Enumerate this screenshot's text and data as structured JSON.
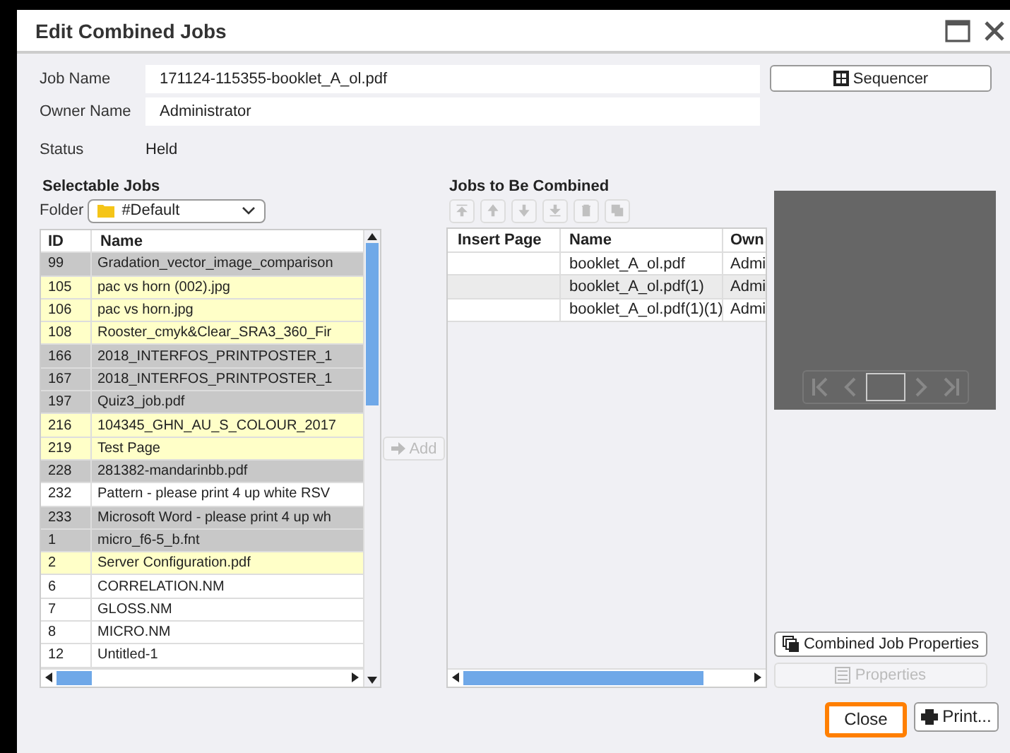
{
  "window": {
    "title": "Edit Combined Jobs"
  },
  "form": [
    {
      "label": "Job Name",
      "kind": "field",
      "value": "171124-115355-booklet_A_ol.pdf"
    },
    {
      "label": "Owner Name",
      "kind": "field",
      "value": "Administrator"
    },
    {
      "label": "Status",
      "kind": "text",
      "value": "Held"
    }
  ],
  "sequencer_button": "Sequencer",
  "selectable_jobs": {
    "title": "Selectable Jobs",
    "folder_label": "Folder",
    "folder": "#Default",
    "columns": [
      "ID",
      "Name"
    ],
    "rows": [
      {
        "id": "99",
        "name": "Gradation_vector_image_comparison",
        "color": "#c8c8c8"
      },
      {
        "id": "105",
        "name": "pac vs horn (002).jpg",
        "color": "#ffffc8"
      },
      {
        "id": "106",
        "name": "pac vs horn.jpg",
        "color": "#ffffc8"
      },
      {
        "id": "108",
        "name": "Rooster_cmyk&Clear_SRA3_360_Fir",
        "color": "#ffffc8"
      },
      {
        "id": "166",
        "name": "2018_INTERFOS_PRINTPOSTER_1",
        "color": "#c8c8c8"
      },
      {
        "id": "167",
        "name": "2018_INTERFOS_PRINTPOSTER_1",
        "color": "#c8c8c8"
      },
      {
        "id": "197",
        "name": "Quiz3_job.pdf",
        "color": "#c8c8c8"
      },
      {
        "id": "216",
        "name": "104345_GHN_AU_S_COLOUR_2017",
        "color": "#ffffc8"
      },
      {
        "id": "219",
        "name": "Test Page",
        "color": "#ffffc8"
      },
      {
        "id": "228",
        "name": "281382-mandarinbb.pdf",
        "color": "#c8c8c8"
      },
      {
        "id": "232",
        "name": "Pattern - please print 4 up white  RSV",
        "color": "#ffffff"
      },
      {
        "id": "233",
        "name": "Microsoft Word - please print 4 up wh",
        "color": "#c8c8c8"
      },
      {
        "id": "1",
        "name": "micro_f6-5_b.fnt",
        "color": "#c8c8c8"
      },
      {
        "id": "2",
        "name": "Server Configuration.pdf",
        "color": "#ffffc8"
      },
      {
        "id": "6",
        "name": "CORRELATION.NM",
        "color": "#ffffff"
      },
      {
        "id": "7",
        "name": "GLOSS.NM",
        "color": "#ffffff"
      },
      {
        "id": "8",
        "name": "MICRO.NM",
        "color": "#ffffff"
      },
      {
        "id": "12",
        "name": "Untitled-1",
        "color": "#ffffff"
      }
    ]
  },
  "add_button": {
    "label": "Add",
    "disabled": true
  },
  "jobs_to_combine": {
    "title": "Jobs to Be Combined",
    "toolbar": [
      {
        "kind": "top",
        "disabled": true
      },
      {
        "kind": "up",
        "disabled": true
      },
      {
        "kind": "down",
        "disabled": true
      },
      {
        "kind": "bottom",
        "disabled": true
      },
      {
        "kind": "delete",
        "disabled": true
      },
      {
        "kind": "copy",
        "disabled": true
      }
    ],
    "columns": [
      "Insert Page",
      "Name",
      "Own"
    ],
    "rows": [
      {
        "insert_page": "",
        "name": "booklet_A_ol.pdf",
        "owner": "Admi",
        "selected": false
      },
      {
        "insert_page": "",
        "name": "booklet_A_ol.pdf(1)",
        "owner": "Admi",
        "selected": true
      },
      {
        "insert_page": "",
        "name": "booklet_A_ol.pdf(1)(1)",
        "owner": "Admi",
        "selected": false
      }
    ]
  },
  "combined_job_properties_button": {
    "label": "Combined Job Properties",
    "disabled": false
  },
  "properties_button": {
    "label": "Properties",
    "disabled": true
  },
  "buttons": [
    {
      "label": "Close",
      "kind": "close",
      "highlighted": true
    },
    {
      "label": "Print...",
      "kind": "print",
      "highlighted": false
    }
  ]
}
